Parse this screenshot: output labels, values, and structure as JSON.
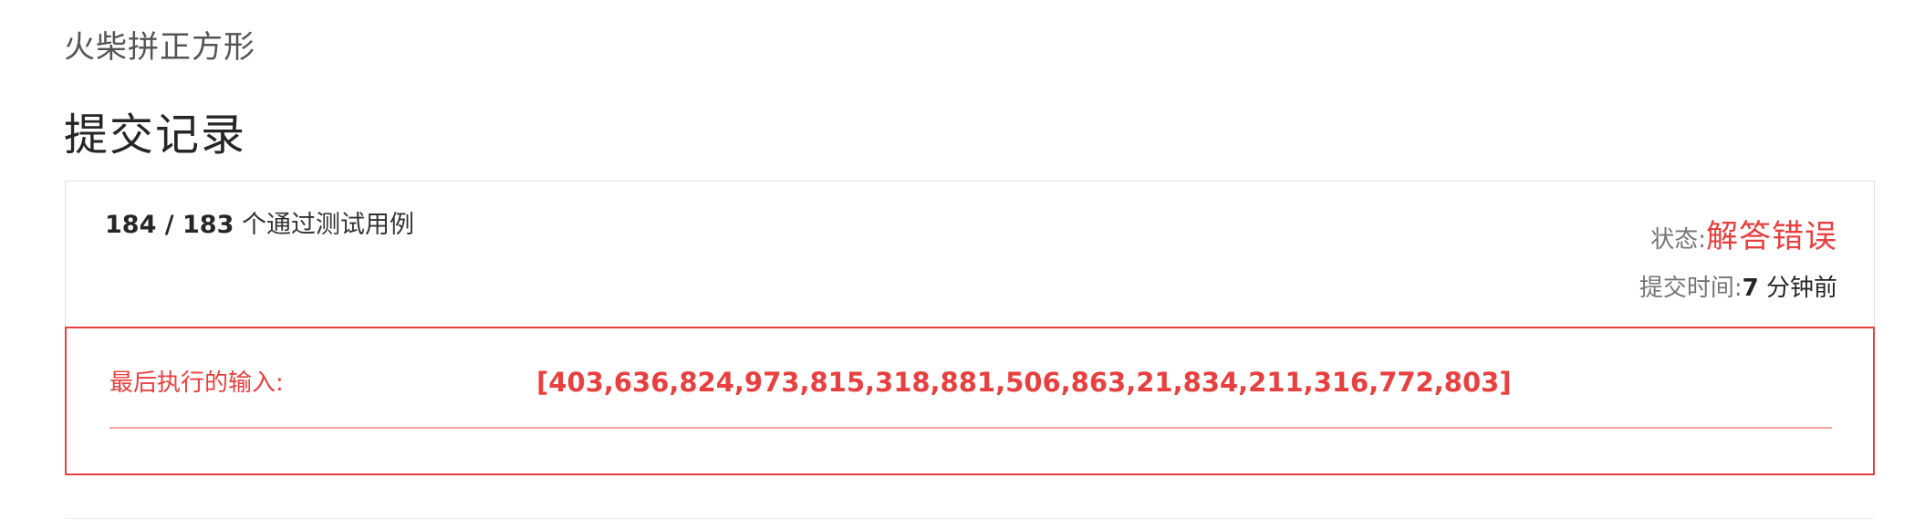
{
  "problem": {
    "title": "火柴拼正方形"
  },
  "page": {
    "section_title": "提交记录"
  },
  "submission": {
    "passed_count": "184 / 183",
    "passed_suffix": "个通过测试用例",
    "status_label": "状态:",
    "status_value": "解答错误",
    "time_label": "提交时间:",
    "time_number": "7",
    "time_unit": "分钟前"
  },
  "last_input": {
    "label": "最后执行的输入:",
    "value": "[403,636,824,973,815,318,881,506,863,21,834,211,316,772,803]"
  },
  "colors": {
    "error": "#e84040",
    "muted": "#757575",
    "text": "#262626",
    "border": "#e0e0e0"
  }
}
